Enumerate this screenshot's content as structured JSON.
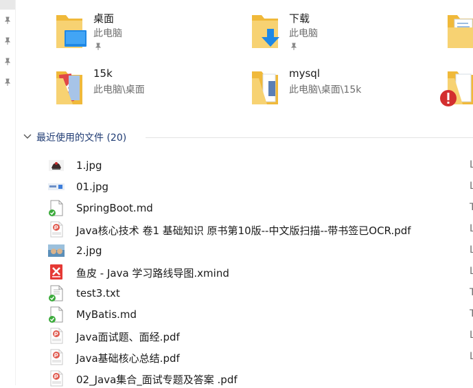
{
  "quick_access": [
    {
      "name": "桌面",
      "location": "此电脑",
      "pinned": true,
      "icon": "desktop-folder-icon"
    },
    {
      "name": "下载",
      "location": "此电脑",
      "pinned": true,
      "icon": "downloads-folder-icon"
    },
    {
      "name": "15k",
      "location": "此电脑\\桌面",
      "pinned": false,
      "icon": "folder-icon"
    },
    {
      "name": "mysql",
      "location": "此电脑\\桌面\\15k",
      "pinned": false,
      "icon": "folder-icon"
    }
  ],
  "recent": {
    "header": "最近使用的文件 (20)",
    "files": [
      {
        "name": "1.jpg",
        "type": "image",
        "col": "L"
      },
      {
        "name": "01.jpg",
        "type": "image",
        "col": "L"
      },
      {
        "name": "SpringBoot.md",
        "type": "doc-synced",
        "col": "T"
      },
      {
        "name": "Java核心技术 卷1  基础知识  原书第10版--中文版扫描--带书签已OCR.pdf",
        "type": "pdf",
        "col": "L"
      },
      {
        "name": "2.jpg",
        "type": "image",
        "col": "L"
      },
      {
        "name": "鱼皮 - Java 学习路线导图.xmind",
        "type": "xmind",
        "col": "L"
      },
      {
        "name": "test3.txt",
        "type": "doc-synced",
        "col": "T"
      },
      {
        "name": "MyBatis.md",
        "type": "doc-synced",
        "col": "T"
      },
      {
        "name": "Java面试题、面经.pdf",
        "type": "pdf",
        "col": "L"
      },
      {
        "name": "Java基础核心总结.pdf",
        "type": "pdf",
        "col": "L"
      },
      {
        "name": "02_Java集合_面试专题及答案 .pdf",
        "type": "pdf",
        "col": "L"
      }
    ]
  },
  "colors": {
    "accent": "#1f3b73",
    "folder": "#f5c84c",
    "pdf": "#e05a4f",
    "sync": "#3cab3c"
  }
}
